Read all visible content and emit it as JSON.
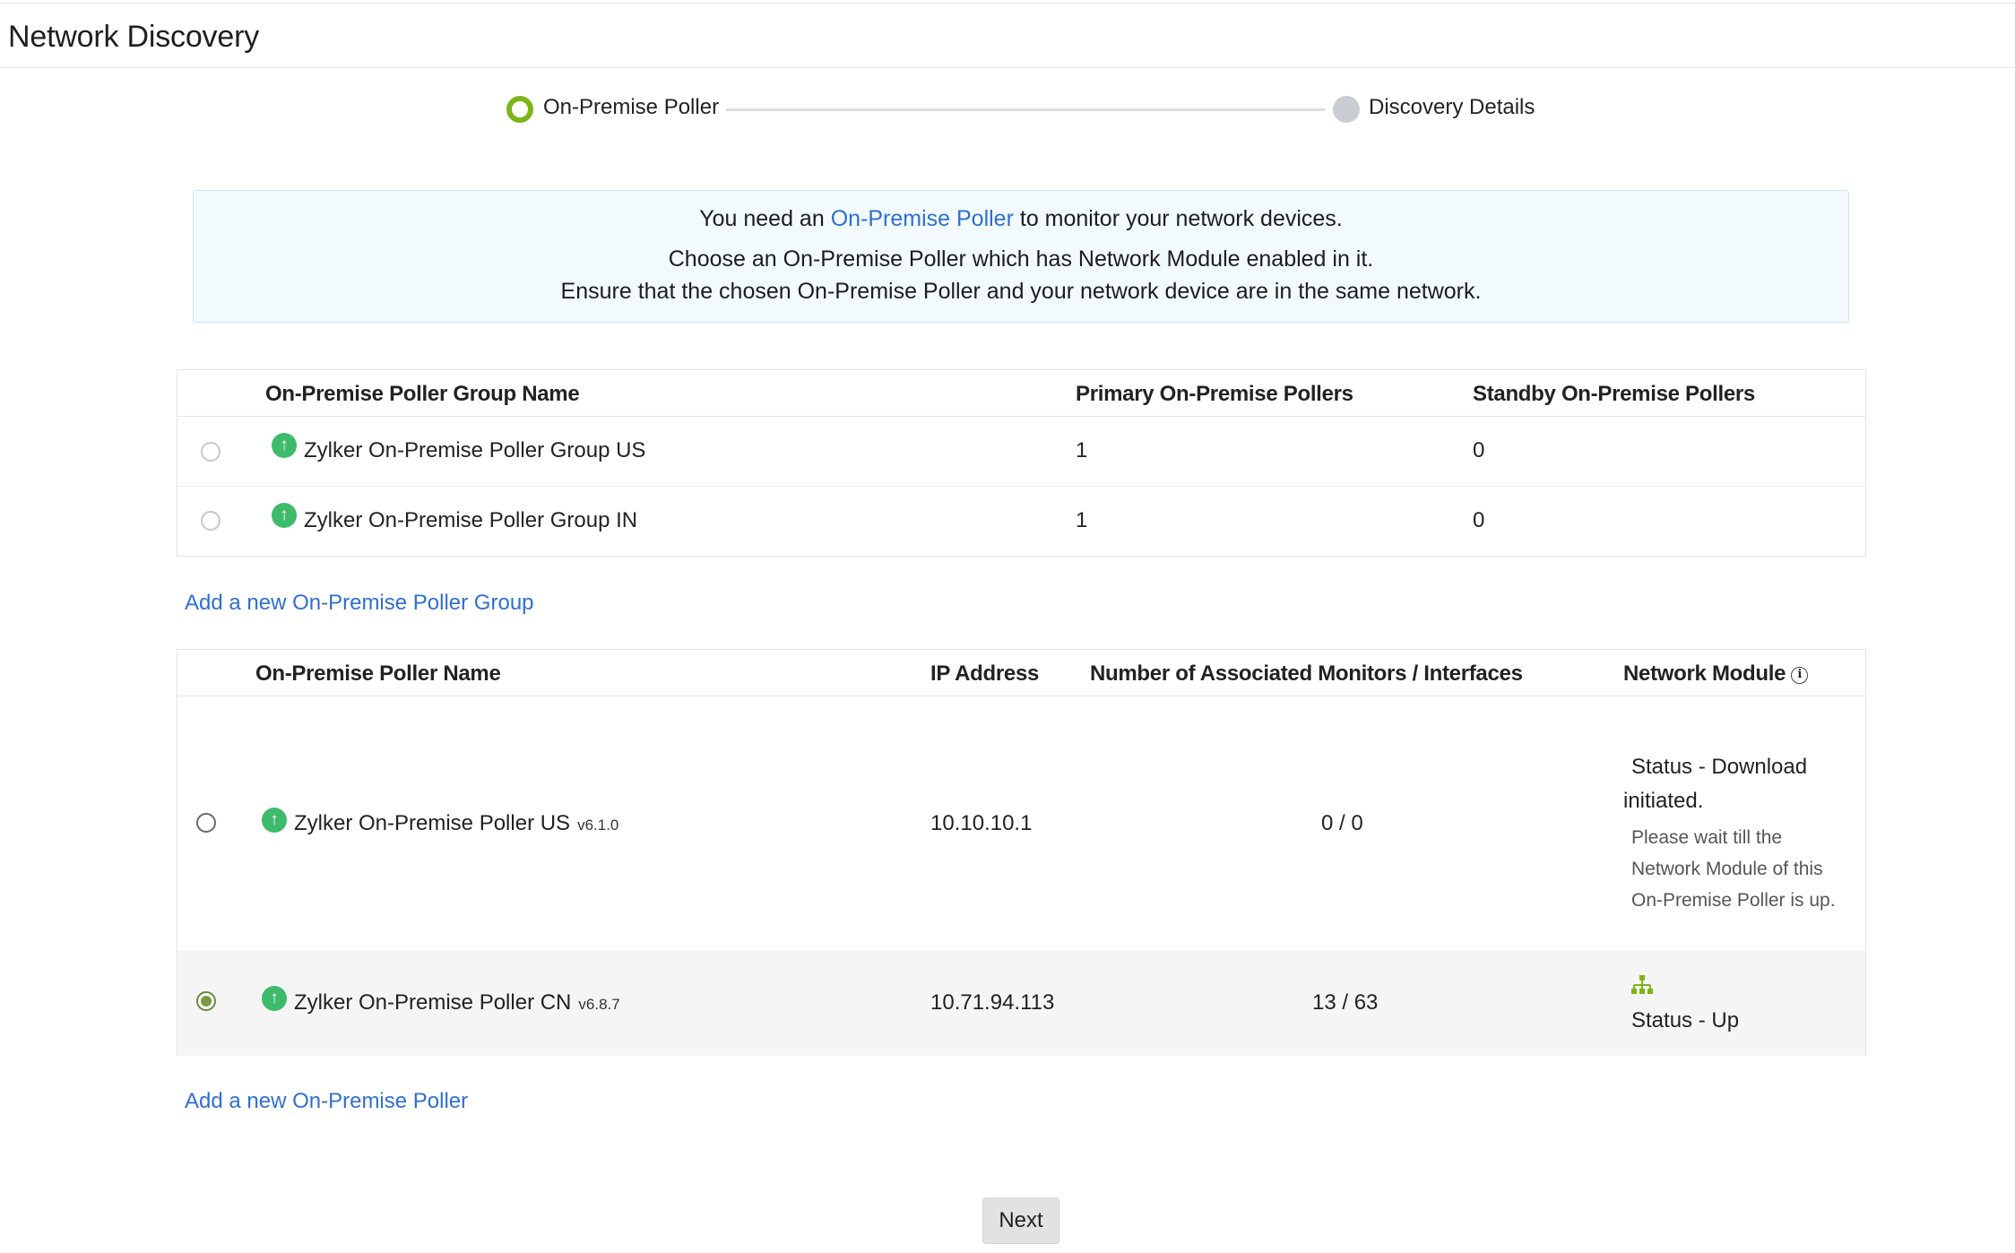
{
  "page": {
    "title": "Network Discovery"
  },
  "stepper": {
    "steps": [
      {
        "label": "On-Premise Poller",
        "state": "active"
      },
      {
        "label": "Discovery Details",
        "state": "inactive"
      }
    ],
    "active_color": "#7cb518"
  },
  "info": {
    "line1_prefix": "You need an",
    "line1_link": "On-Premise Poller",
    "line1_suffix": "to monitor your network devices.",
    "line2": "Choose an On-Premise Poller which has Network Module enabled in it.",
    "line3": "Ensure that the chosen On-Premise Poller and your network device are in the same network."
  },
  "group_table": {
    "headers": [
      "On-Premise Poller Group Name",
      "Primary On-Premise Pollers",
      "Standby On-Premise Pollers"
    ],
    "rows": [
      {
        "name": "Zylker On-Premise Poller Group US",
        "primary": "1",
        "standby": "0",
        "selected": false,
        "status_icon": "arrow-up-icon"
      },
      {
        "name": "Zylker On-Premise Poller Group IN",
        "primary": "1",
        "standby": "0",
        "selected": false,
        "status_icon": "arrow-up-icon"
      }
    ],
    "add_link": "Add a new On-Premise Poller Group"
  },
  "poller_table": {
    "headers": [
      "On-Premise Poller Name",
      "IP Address",
      "Number of Associated Monitors / Interfaces",
      "Network Module"
    ],
    "header_info_icon": "info-icon",
    "rows": [
      {
        "name": "Zylker On-Premise Poller US",
        "version": "v6.1.0",
        "ip": "10.10.10.1",
        "monitors": "0 / 0",
        "status": "Status - Download initiated.",
        "note": "Please wait till the Network Module of this On-Premise Poller is up.",
        "selected": false,
        "status_icon": "arrow-up-icon"
      },
      {
        "name": "Zylker On-Premise Poller CN",
        "version": "v6.8.7",
        "ip": "10.71.94.113",
        "monitors": "13 / 63",
        "status": "Status - Up",
        "module_icon": "network-topology-icon",
        "selected": true,
        "status_icon": "arrow-up-icon"
      }
    ],
    "add_link": "Add a new On-Premise Poller"
  },
  "footer": {
    "next_label": "Next"
  },
  "colors": {
    "link": "#2f6fcf",
    "up": "#3dbb6a",
    "module_up": "#7cb518",
    "info_bg": "#f2fafd"
  }
}
